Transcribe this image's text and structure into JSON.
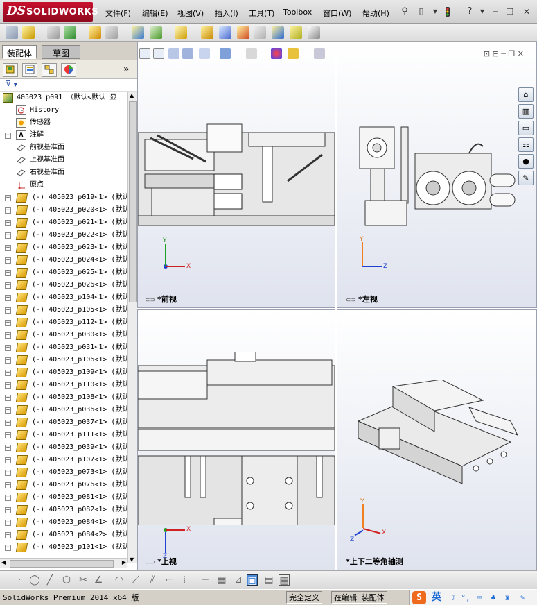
{
  "app": {
    "logo_ds": "DS",
    "logo_text": "SOLIDWORKS"
  },
  "menu": [
    {
      "label": "文件(F)"
    },
    {
      "label": "编辑(E)"
    },
    {
      "label": "视图(V)"
    },
    {
      "label": "插入(I)"
    },
    {
      "label": "工具(T)"
    },
    {
      "label": "Toolbox"
    },
    {
      "label": "窗口(W)"
    },
    {
      "label": "帮助(H)"
    }
  ],
  "window_controls": {
    "minimize": "─",
    "restore": "❐",
    "close": "✕"
  },
  "left_panel": {
    "tabs": [
      {
        "label": "装配体"
      },
      {
        "label": "草图"
      }
    ],
    "expand_glyph": "»",
    "filter_glyph": "▼"
  },
  "tree": {
    "root": "405023_p091 （默认<默认_显",
    "feature_nodes": [
      {
        "label": "History",
        "icon": "history-icon"
      },
      {
        "label": "传感器",
        "icon": "sensor-icon"
      },
      {
        "label": "注解",
        "icon": "annotation-icon"
      },
      {
        "label": "前视基准面",
        "icon": "plane-icon"
      },
      {
        "label": "上视基准面",
        "icon": "plane-icon"
      },
      {
        "label": "右视基准面",
        "icon": "plane-icon"
      },
      {
        "label": "原点",
        "icon": "origin-icon"
      }
    ],
    "parts": [
      {
        "label": "(-)  405023_p019<1> (默认"
      },
      {
        "label": "(-)  405023_p020<1> (默认"
      },
      {
        "label": "(-)  405023_p021<1> (默认"
      },
      {
        "label": "(-)  405023_p022<1> (默认"
      },
      {
        "label": "(-)  405023_p023<1> (默认"
      },
      {
        "label": "(-)  405023_p024<1> (默认"
      },
      {
        "label": "(-)  405023_p025<1> (默认"
      },
      {
        "label": "(-)  405023_p026<1> (默认"
      },
      {
        "label": "(-)  405023_p104<1> (默认"
      },
      {
        "label": "(-)  405023_p105<1> (默认"
      },
      {
        "label": "(-)  405023_p112<1> (默认"
      },
      {
        "label": "(-)  405023_p030<1> (默认"
      },
      {
        "label": "(-)  405023_p031<1> (默认"
      },
      {
        "label": "(-)  405023_p106<1> (默认"
      },
      {
        "label": "(-)  405023_p109<1> (默认"
      },
      {
        "label": "(-)  405023_p110<1> (默认"
      },
      {
        "label": "(-)  405023_p108<1> (默认"
      },
      {
        "label": "(-)  405023_p036<1> (默认"
      },
      {
        "label": "(-)  405023_p037<1> (默认"
      },
      {
        "label": "(-)  405023_p111<1> (默认"
      },
      {
        "label": "(-)  405023_p039<1> (默认"
      },
      {
        "label": "(-)  405023_p107<1> (默认"
      },
      {
        "label": "(-)  405023_p073<1> (默认"
      },
      {
        "label": "(-)  405023_p076<1> (默认"
      },
      {
        "label": "(-)  405023_p081<1> (默认"
      },
      {
        "label": "(-)  405023_p082<1> (默认"
      },
      {
        "label": "(-)  405023_p084<1> (默认"
      },
      {
        "label": "(-)  405023_p084<2> (默认"
      },
      {
        "label": "(-)  405023_p101<1> (默认"
      }
    ]
  },
  "viewports": {
    "front": {
      "label": "*前视"
    },
    "left": {
      "label": "*左视"
    },
    "top": {
      "label": "*上视"
    },
    "iso": {
      "label": "*上下二等角轴测"
    },
    "link_glyph": "⊂⊃"
  },
  "axes": {
    "x": "X",
    "y": "Y",
    "z": "Z"
  },
  "viewport_controls": "⊡ ⊟  ─ ❐ ✕",
  "status": {
    "product": "SolidWorks Premium 2014 x64 版",
    "definition": "完全定义",
    "mode": "在编辑 装配体"
  },
  "ime": {
    "logo": "S",
    "language": "英"
  },
  "colors": {
    "accent_red": "#c8102e",
    "axis_x": "#d02020",
    "axis_y": "#20a020",
    "axis_z": "#2040d0",
    "part_yellow": "#f2c200"
  }
}
